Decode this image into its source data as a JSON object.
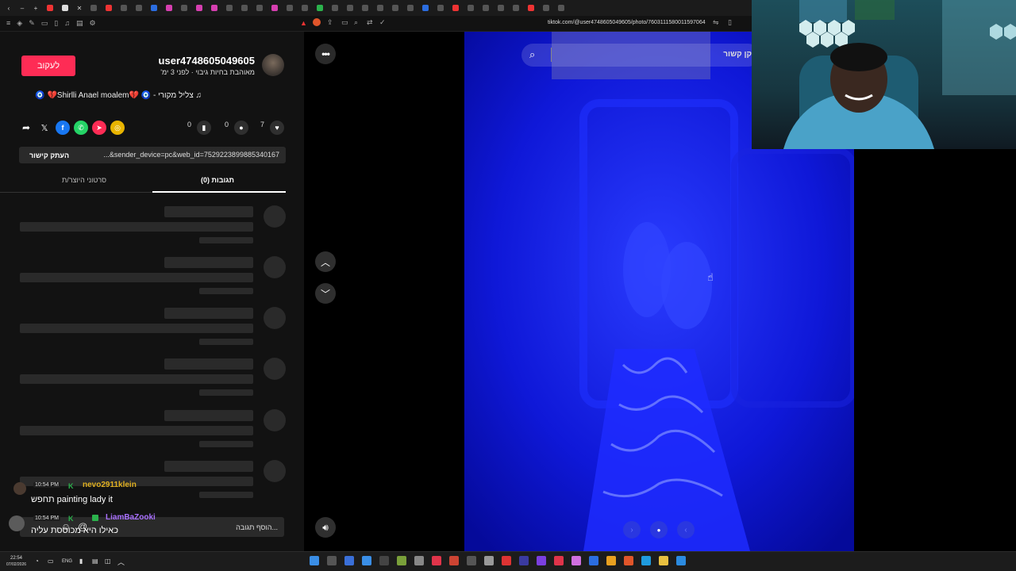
{
  "browser": {
    "url": "tiktok.com/@user4748605049605/photo/7603111580011597064"
  },
  "profile": {
    "follow_label": "לעקוב",
    "username": "user4748605049605",
    "subtitle": "מאוהבת בחיות גיבוי · לפני 3 ימ'",
    "music": "צליל מקורי - 🧿 💔Shirlli Anael moalem💔 🧿"
  },
  "actions": {
    "likes": "7",
    "comments": "0",
    "bookmarks": "0"
  },
  "link": {
    "copy_label": "העתק קישור",
    "value": "...&sender_device=pc&web_id=7529223899885340167"
  },
  "tabs": [
    {
      "label": "תגובות (0)"
    },
    {
      "label": "סרטוני היוצר/ת"
    }
  ],
  "search": {
    "placeholder": "קן קשור"
  },
  "comment_input": {
    "placeholder": "הוסף תגובה..."
  },
  "stream_chat": [
    {
      "time": "10:54 PM",
      "user": "nevo2911klein",
      "user_color": "#e0b020",
      "message": "תחפש painting lady it"
    },
    {
      "time": "10:54 PM",
      "user": "LiamBaZooki",
      "user_color": "#a970ff",
      "message": "כאילו היא מכוססת עליה"
    }
  ],
  "taskbar": {
    "lang": "ENG",
    "time": "22:54",
    "date": "07/02/2026"
  },
  "colors": {
    "accent": "#fe2c55",
    "photo_blue": "#0a0cc8"
  }
}
